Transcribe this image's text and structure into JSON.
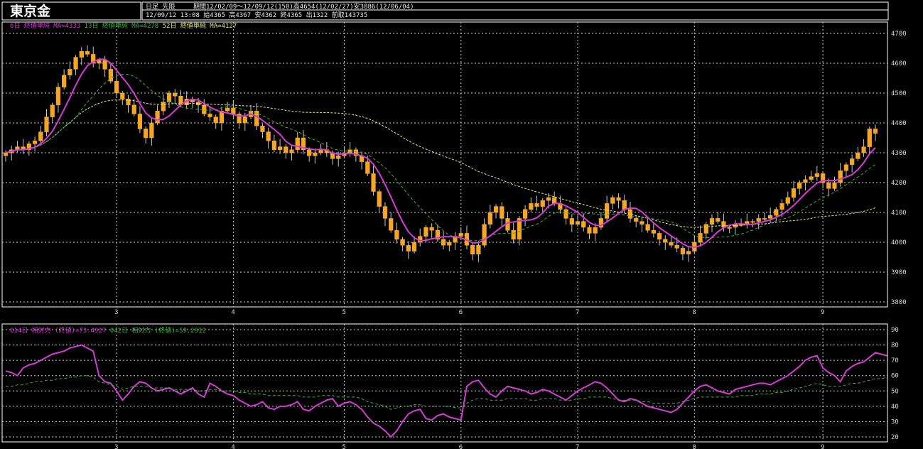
{
  "header": {
    "title": "東京金",
    "mode": "日足 先限",
    "period": "期間12/02/09～12/09/12(150)高4654(12/02/27)安3886(12/06/04)",
    "last_bar": "12/09/12 13:08 始4365 高4367 安4362 終4365 出1322 前取143735"
  },
  "colors": {
    "background": "#000000",
    "frame": "#ffffff",
    "grid": "#cfcfcf",
    "candle": "#f5a623",
    "wick": "#c8c8c8",
    "ma6": "#d63bd6",
    "ma13": "#39b339",
    "ma52": "#e6e680",
    "rsi14": "#d63bd6",
    "rsi42": "#39b339"
  },
  "chart_data": [
    {
      "type": "candlestick",
      "legend": [
        {
          "name": "6日 終値単純 MA=4333",
          "color": "ma6"
        },
        {
          "name": "13日 終値単純 MA=4278",
          "color": "ma13"
        },
        {
          "name": "52日 終値単純 MA=4127",
          "color": "ma52"
        }
      ],
      "ylim": [
        3800,
        4700
      ],
      "yticks": [
        3800,
        3900,
        4000,
        4100,
        4200,
        4300,
        4400,
        4500,
        4600,
        4700
      ],
      "month_labels": [
        {
          "label": "3",
          "index": 19
        },
        {
          "label": "4",
          "index": 39
        },
        {
          "label": "5",
          "index": 58
        },
        {
          "label": "6",
          "index": 78
        },
        {
          "label": "7",
          "index": 98
        },
        {
          "label": "8",
          "index": 118
        },
        {
          "label": "9",
          "index": 140
        }
      ],
      "closes": [
        4300,
        4310,
        4320,
        4310,
        4330,
        4340,
        4370,
        4420,
        4460,
        4520,
        4560,
        4580,
        4620,
        4640,
        4630,
        4600,
        4610,
        4580,
        4540,
        4500,
        4480,
        4460,
        4430,
        4380,
        4350,
        4400,
        4440,
        4470,
        4500,
        4490,
        4460,
        4480,
        4470,
        4460,
        4430,
        4420,
        4400,
        4440,
        4450,
        4430,
        4400,
        4420,
        4440,
        4390,
        4370,
        4340,
        4310,
        4320,
        4300,
        4310,
        4350,
        4310,
        4290,
        4300,
        4310,
        4300,
        4280,
        4290,
        4300,
        4310,
        4290,
        4270,
        4230,
        4170,
        4120,
        4080,
        4040,
        4010,
        3990,
        3970,
        4000,
        4020,
        4050,
        4040,
        4010,
        3990,
        4000,
        4020,
        4030,
        3990,
        3960,
        3990,
        4060,
        4100,
        4120,
        4080,
        4040,
        4010,
        4080,
        4110,
        4130,
        4120,
        4140,
        4150,
        4130,
        4110,
        4080,
        4060,
        4070,
        4050,
        4030,
        4050,
        4080,
        4130,
        4150,
        4140,
        4110,
        4080,
        4070,
        4060,
        4040,
        4030,
        4010,
        4000,
        3990,
        3980,
        3960,
        3970,
        4000,
        4030,
        4060,
        4080,
        4070,
        4050,
        4050,
        4060,
        4060,
        4070,
        4070,
        4080,
        4080,
        4090,
        4110,
        4130,
        4150,
        4180,
        4200,
        4210,
        4220,
        4230,
        4200,
        4180,
        4200,
        4240,
        4260,
        4280,
        4300,
        4320,
        4380,
        4365
      ]
    },
    {
      "type": "line",
      "legend": [
        {
          "name": "014日 相対力 (終値)=73.4927",
          "color": "rsi14"
        },
        {
          "name": "042日 相対力 (終値)=59.2912",
          "color": "rsi42"
        }
      ],
      "ylim": [
        20,
        90
      ],
      "yticks": [
        20,
        30,
        40,
        50,
        60,
        70,
        80,
        90
      ],
      "series": [
        {
          "color": "rsi14",
          "values": [
            63,
            62,
            60,
            65,
            67,
            68,
            70,
            72,
            74,
            75,
            76,
            78,
            79,
            80,
            78,
            76,
            60,
            56,
            55,
            50,
            44,
            48,
            53,
            56,
            55,
            52,
            50,
            51,
            52,
            50,
            48,
            50,
            52,
            48,
            46,
            55,
            53,
            50,
            48,
            47,
            44,
            42,
            40,
            41,
            43,
            39,
            38,
            40,
            40,
            41,
            43,
            38,
            37,
            40,
            42,
            44,
            45,
            40,
            42,
            43,
            41,
            38,
            33,
            29,
            27,
            24,
            20,
            24,
            30,
            35,
            37,
            38,
            32,
            31,
            34,
            35,
            33,
            32,
            31,
            53,
            56,
            57,
            52,
            48,
            46,
            50,
            53,
            52,
            51,
            50,
            48,
            49,
            51,
            50,
            48,
            46,
            44,
            47,
            50,
            52,
            54,
            56,
            55,
            52,
            48,
            44,
            43,
            45,
            44,
            42,
            40,
            39,
            38,
            37,
            36,
            38,
            42,
            46,
            50,
            53,
            54,
            52,
            50,
            49,
            48,
            51,
            52,
            53,
            54,
            55,
            55,
            54,
            56,
            58,
            60,
            63,
            66,
            70,
            72,
            73,
            65,
            62,
            60,
            56,
            63,
            66,
            68,
            69,
            72,
            75,
            74,
            73
          ]
        },
        {
          "color": "rsi42",
          "values": [
            53,
            53,
            54,
            54,
            55,
            56,
            56,
            57,
            57,
            58,
            58,
            59,
            59,
            60,
            60,
            59,
            56,
            55,
            54,
            53,
            51,
            52,
            53,
            53,
            53,
            52,
            52,
            52,
            52,
            51,
            51,
            51,
            51,
            50,
            50,
            51,
            51,
            50,
            50,
            50,
            49,
            49,
            48,
            48,
            48,
            47,
            47,
            47,
            47,
            47,
            47,
            46,
            46,
            46,
            47,
            47,
            47,
            46,
            46,
            46,
            46,
            45,
            43,
            42,
            41,
            40,
            38,
            39,
            40,
            40,
            41,
            41,
            40,
            40,
            40,
            40,
            40,
            39,
            39,
            42,
            44,
            45,
            45,
            44,
            44,
            44,
            45,
            45,
            45,
            45,
            44,
            44,
            45,
            45,
            45,
            44,
            44,
            44,
            45,
            45,
            46,
            46,
            46,
            46,
            45,
            44,
            44,
            44,
            44,
            43,
            43,
            42,
            42,
            42,
            42,
            42,
            43,
            44,
            45,
            46,
            46,
            46,
            46,
            46,
            46,
            46,
            47,
            47,
            47,
            48,
            48,
            48,
            49,
            49,
            50,
            51,
            52,
            53,
            54,
            55,
            54,
            53,
            53,
            53,
            54,
            55,
            55,
            56,
            57,
            58,
            58,
            59
          ]
        }
      ]
    }
  ]
}
